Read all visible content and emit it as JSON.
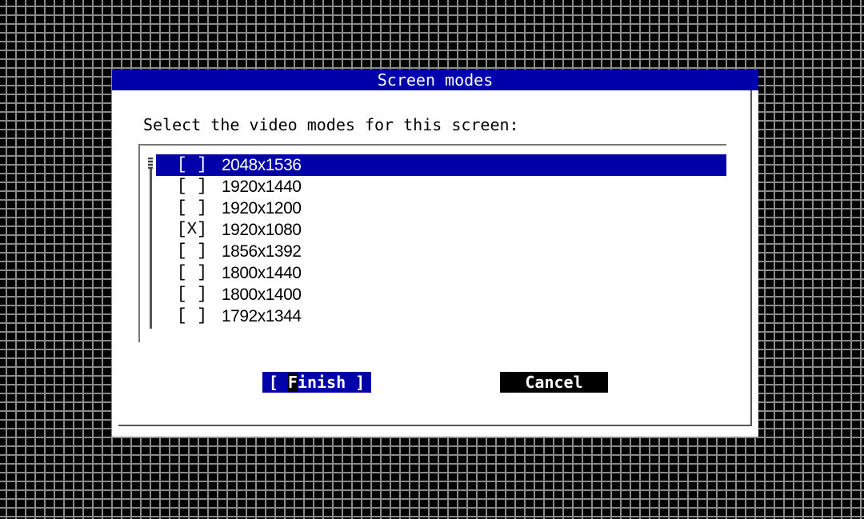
{
  "dialog": {
    "title": "Screen modes",
    "prompt": "Select the video modes for this screen:"
  },
  "modes": [
    {
      "checkbox": "[ ]",
      "label": "2048x1536",
      "selected": true
    },
    {
      "checkbox": "[ ]",
      "label": "1920x1440",
      "selected": false
    },
    {
      "checkbox": "[ ]",
      "label": "1920x1200",
      "selected": false
    },
    {
      "checkbox": "[X]",
      "label": "1920x1080",
      "selected": false
    },
    {
      "checkbox": "[ ]",
      "label": "1856x1392",
      "selected": false
    },
    {
      "checkbox": "[ ]",
      "label": "1800x1440",
      "selected": false
    },
    {
      "checkbox": "[ ]",
      "label": "1800x1400",
      "selected": false
    },
    {
      "checkbox": "[ ]",
      "label": "1792x1344",
      "selected": false
    }
  ],
  "buttons": {
    "finish_open": "[ ",
    "finish_hotkey": "F",
    "finish_rest": "inish ]",
    "cancel": "Cancel"
  },
  "colors": {
    "accent": "#0000aa",
    "background": "#000000",
    "grid": "#8a8a8a",
    "dialog": "#ffffff"
  }
}
